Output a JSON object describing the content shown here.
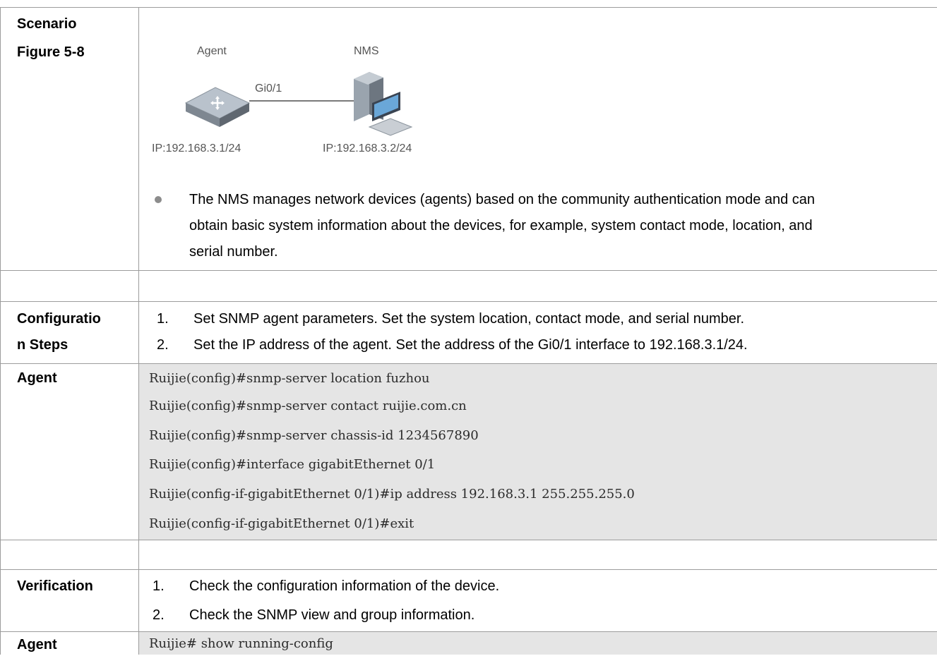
{
  "scenario": {
    "label_line1": "Scenario",
    "label_line2": "Figure 5-8",
    "figure": {
      "agent_label": "Agent",
      "nms_label": "NMS",
      "link_label": "Gi0/1",
      "agent_ip": "IP:192.168.3.1/24",
      "nms_ip": "IP:192.168.3.2/24"
    },
    "bullet_lines": [
      "The NMS manages network devices (agents) based on the community authentication mode and can",
      "obtain basic system information about the devices, for example, system contact mode, location, and",
      "serial number."
    ]
  },
  "config_steps": {
    "label_line1": "Configuratio",
    "label_line2": "n Steps",
    "steps": [
      {
        "num": "1.",
        "text": "Set SNMP agent parameters. Set the system location, contact mode, and serial number."
      },
      {
        "num": "2.",
        "text": "Set the IP address of the agent. Set the address of the Gi0/1 interface to 192.168.3.1/24."
      }
    ]
  },
  "agent_config": {
    "label": "Agent",
    "lines": [
      "Ruijie(config)#snmp-server location fuzhou",
      "Ruijie(config)#snmp-server contact ruijie.com.cn",
      "Ruijie(config)#snmp-server chassis-id 1234567890",
      "Ruijie(config)#interface gigabitEthernet 0/1",
      "Ruijie(config-if-gigabitEthernet 0/1)#ip address 192.168.3.1 255.255.255.0",
      "Ruijie(config-if-gigabitEthernet 0/1)#exit"
    ]
  },
  "verification": {
    "label": "Verification",
    "steps": [
      {
        "num": "1.",
        "text": "Check the configuration information of the device."
      },
      {
        "num": "2.",
        "text": "Check the SNMP view and group information."
      }
    ]
  },
  "agent_verify": {
    "label": "Agent",
    "lines": [
      "Ruijie# show running-config"
    ]
  }
}
